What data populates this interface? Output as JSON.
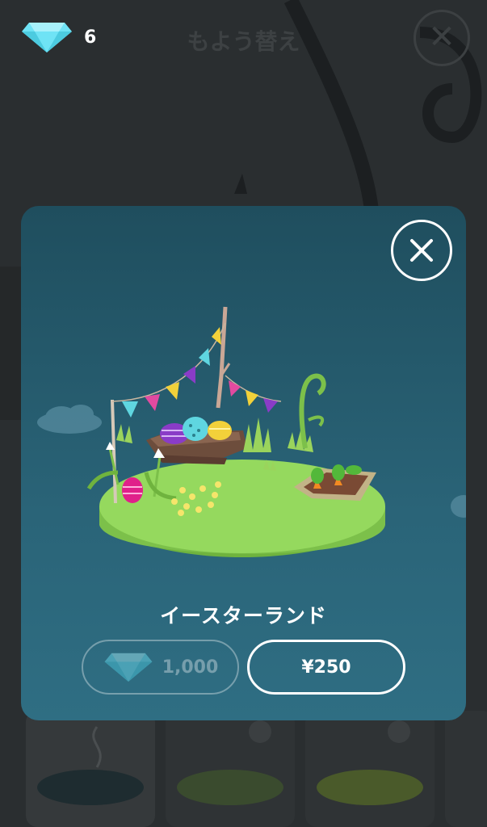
{
  "header": {
    "gem_icon": "diamond-icon",
    "gem_count": "6",
    "title": "もよう替え",
    "close_icon": "close-icon"
  },
  "modal": {
    "close_icon": "close-icon",
    "item_name": "イースターランド",
    "gem_price": "1,000",
    "yen_price": "¥250"
  },
  "colors": {
    "modal_bg": "#2a6478",
    "gem": "#6fe3f5",
    "egg_purple": "#8a3cc7",
    "egg_teal": "#5fd6e0",
    "egg_yellow": "#f2d13a",
    "egg_pink": "#e0208a",
    "island_grass": "#8fd45a"
  }
}
